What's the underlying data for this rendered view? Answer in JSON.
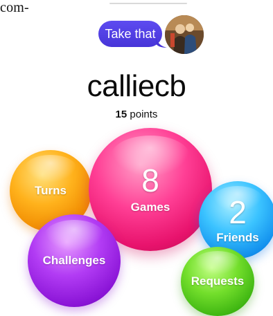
{
  "header": {
    "stray_text": "com-"
  },
  "message": {
    "bubble_text": "Take that",
    "bubble_color": "#4f3de4"
  },
  "profile": {
    "username": "calliecb",
    "points_value": "15",
    "points_unit": "points"
  },
  "bubbles": {
    "turns": {
      "label": "Turns",
      "color": "#ffb21c"
    },
    "games": {
      "count": "8",
      "label": "Games",
      "color": "#ff3f95"
    },
    "friends": {
      "count": "2",
      "label": "Friends",
      "color": "#3bc3ff"
    },
    "challenges": {
      "label": "Challenges",
      "color": "#b23cf4"
    },
    "requests": {
      "label": "Requests",
      "color": "#74df2c"
    }
  },
  "icons": {
    "avatar": "avatar-photo-icon"
  }
}
